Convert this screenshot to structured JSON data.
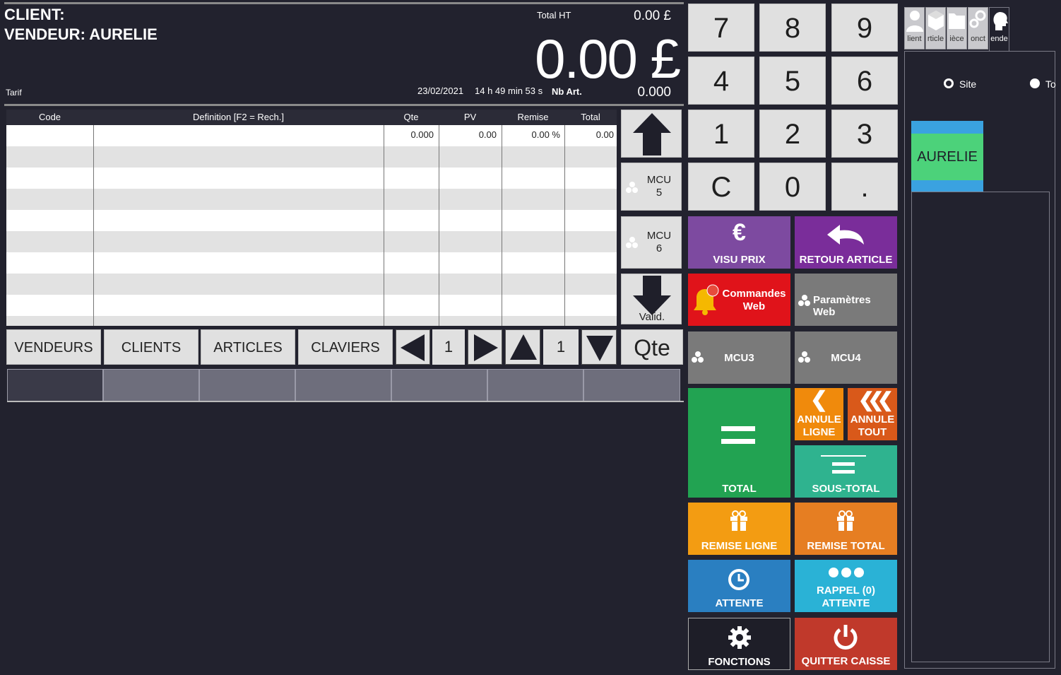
{
  "header": {
    "client_label": "CLIENT:",
    "vendeur_label": "VENDEUR: AURELIE",
    "tarif_label": "Tarif",
    "total_ht_label": "Total HT",
    "total_ht_value": "0.00 £",
    "big_total": "0.00 £",
    "date": "23/02/2021",
    "time": "14 h 49 min 53 s",
    "nb_art_label": "Nb Art.",
    "nb_art_value": "0.000"
  },
  "table": {
    "columns": [
      "Code",
      "Definition [F2 = Rech.]",
      "Qte",
      "PV",
      "Remise",
      "Total"
    ],
    "first_row": {
      "qte": "0.000",
      "pv": "0.00",
      "remise": "0.00 %",
      "total": "0.00"
    }
  },
  "side_buttons": {
    "mcu5_line1": "MCU",
    "mcu5_line2": "5",
    "mcu6_line1": "MCU",
    "mcu6_line2": "6",
    "valid_label": "Valid.",
    "qte_label": "Qte"
  },
  "numpad": [
    "7",
    "8",
    "9",
    "4",
    "5",
    "6",
    "1",
    "2",
    "3",
    "C",
    "0",
    "."
  ],
  "tiles": {
    "visu_prix": "VISU PRIX",
    "retour_article": "RETOUR ARTICLE",
    "commandes_web_l1": "Commandes",
    "commandes_web_l2": "Web",
    "parametres_web": "Paramètres Web",
    "mcu3": "MCU3",
    "mcu4": "MCU4",
    "total": "TOTAL",
    "annule_ligne_l1": "ANNULE",
    "annule_ligne_l2": "LIGNE",
    "annule_tout_l1": "ANNULE",
    "annule_tout_l2": "TOUT",
    "sous_total": "SOUS-TOTAL",
    "remise_ligne": "REMISE LIGNE",
    "remise_total": "REMISE TOTAL",
    "attente": "ATTENTE",
    "rappel_l1": "RAPPEL (0)",
    "rappel_l2": "ATTENTE",
    "fonctions": "FONCTIONS",
    "quitter_caisse": "QUITTER CAISSE"
  },
  "nav": {
    "vendeurs": "VENDEURS",
    "clients": "CLIENTS",
    "articles": "ARTICLES",
    "claviers": "CLAVIERS",
    "page_h": "1",
    "page_v": "1"
  },
  "right_panel": {
    "tabs": [
      "lient",
      "rticle",
      "ièce",
      "onct",
      "ende"
    ],
    "radio_site": "Site",
    "radio_to": "To",
    "vendeur_name": "AURELIE"
  },
  "colors": {
    "background": "#22222e",
    "purple": "#7d4aa0",
    "red": "#e0131a",
    "gray_tile": "#7a7a7a",
    "green": "#22a352",
    "orange": "#f08a0c",
    "dark_orange": "#d9591a",
    "teal": "#2fb38f",
    "yellow_orange": "#f39c12",
    "blue": "#2a7fc1",
    "light_blue": "#2ab2d6",
    "quit_red": "#c0392b",
    "aurelie_green": "#4cd27a"
  }
}
